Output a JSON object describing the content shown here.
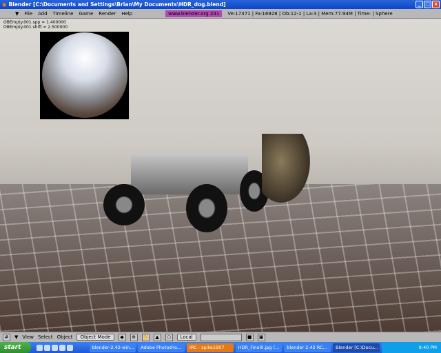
{
  "window": {
    "title": "Blender [C:\\Documents and Settings\\Brian\\My Documents\\HDR_dog.blend]"
  },
  "menu": {
    "items": [
      "File",
      "Add",
      "Timeline",
      "Game",
      "Render",
      "Help"
    ],
    "website": "www.blender.org 241",
    "stats": "Ve:17371 | Fa:16928 | Ob:12-1 | La:3  | Mem:77.94M  | Time: | Sphere"
  },
  "viewport": {
    "overlay_lines": [
      "OBEmpty.001.spp = 1.400000",
      "OBEmpty.001.shift = 2.500000"
    ]
  },
  "header": {
    "items": [
      "View",
      "Select",
      "Object"
    ],
    "mode": "Object Mode",
    "orientation": "Local"
  },
  "taskbar": {
    "start": "start",
    "tasks": [
      "blender-2.42-win...",
      "Adobe Photosho...",
      "IRC - spike1907",
      "HDR_Final0.jpg (...",
      "blender 2.42 RC...",
      "Blender [C:\\Docu..."
    ],
    "clock": "9:40 PM"
  }
}
